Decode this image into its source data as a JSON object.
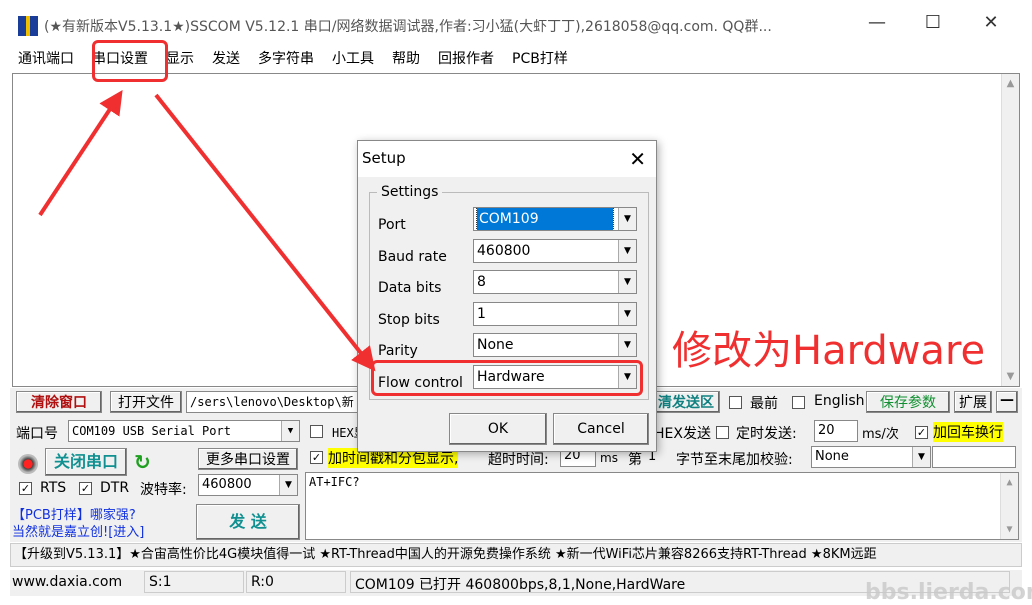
{
  "window": {
    "title": "(★有新版本V5.13.1★)SSCOM V5.12.1 串口/网络数据调试器,作者:习小猛(大虾丁丁),2618058@qq.com. QQ群...",
    "minimize": "—",
    "maximize": "☐",
    "close": "✕"
  },
  "menu": [
    "通讯端口",
    "串口设置",
    "显示",
    "发送",
    "多字符串",
    "小工具",
    "帮助",
    "回报作者",
    "PCB打样"
  ],
  "toolbar": {
    "clear": "清除窗口",
    "open_file": "打开文件",
    "file_path": "/sers\\lenovo\\Desktop\\新",
    "clear_send": "清发送区",
    "topmost": "最前",
    "english": "English",
    "save_params": "保存参数",
    "expand": "扩展",
    "collapse": "—"
  },
  "port": {
    "label": "端口号",
    "value": "COM109 USB Serial Port",
    "close_port": "关闭串口",
    "more_settings": "更多串口设置",
    "rts": "RTS",
    "dtr": "DTR",
    "baud_label": "波特率:",
    "baud": "460800",
    "ad1": "【PCB打样】哪家强?",
    "ad2": "当然就是嘉立创![进入]",
    "send": "发 送"
  },
  "options": {
    "hex_show": "HEX显示",
    "timestamp": "加时间戳和分包显示,",
    "timeout_label": "超时时间:",
    "timeout": "20",
    "ms": "ms",
    "nth": "第",
    "nth_val": "1",
    "hex_send": "HEX发送",
    "timed_send": "定时发送:",
    "interval": "20",
    "interval_unit": "ms/次",
    "crlf": "加回车换行",
    "checksum_label": "字节至末尾加校验:",
    "checksum": "None",
    "send_text": "AT+IFC?"
  },
  "marquee": "【升级到V5.13.1】★合宙高性价比4G模块值得一试 ★RT-Thread中国人的开源免费操作系统 ★新一代WiFi芯片兼容8266支持RT-Thread ★8KM远距",
  "status": {
    "site": "www.daxia.com",
    "sent": "S:1",
    "recv": "R:0",
    "info": "COM109 已打开  460800bps,8,1,None,HardWare"
  },
  "dialog": {
    "title": "Setup",
    "group": "Settings",
    "fields": [
      {
        "label": "Port",
        "value": "COM109"
      },
      {
        "label": "Baud rate",
        "value": "460800"
      },
      {
        "label": "Data bits",
        "value": "8"
      },
      {
        "label": "Stop bits",
        "value": "1"
      },
      {
        "label": "Parity",
        "value": "None"
      },
      {
        "label": "Flow control",
        "value": "Hardware"
      }
    ],
    "ok": "OK",
    "cancel": "Cancel"
  },
  "annotation": {
    "text": "修改为Hardware",
    "color": "#f03030"
  },
  "watermark": "bbs.lierda.com"
}
